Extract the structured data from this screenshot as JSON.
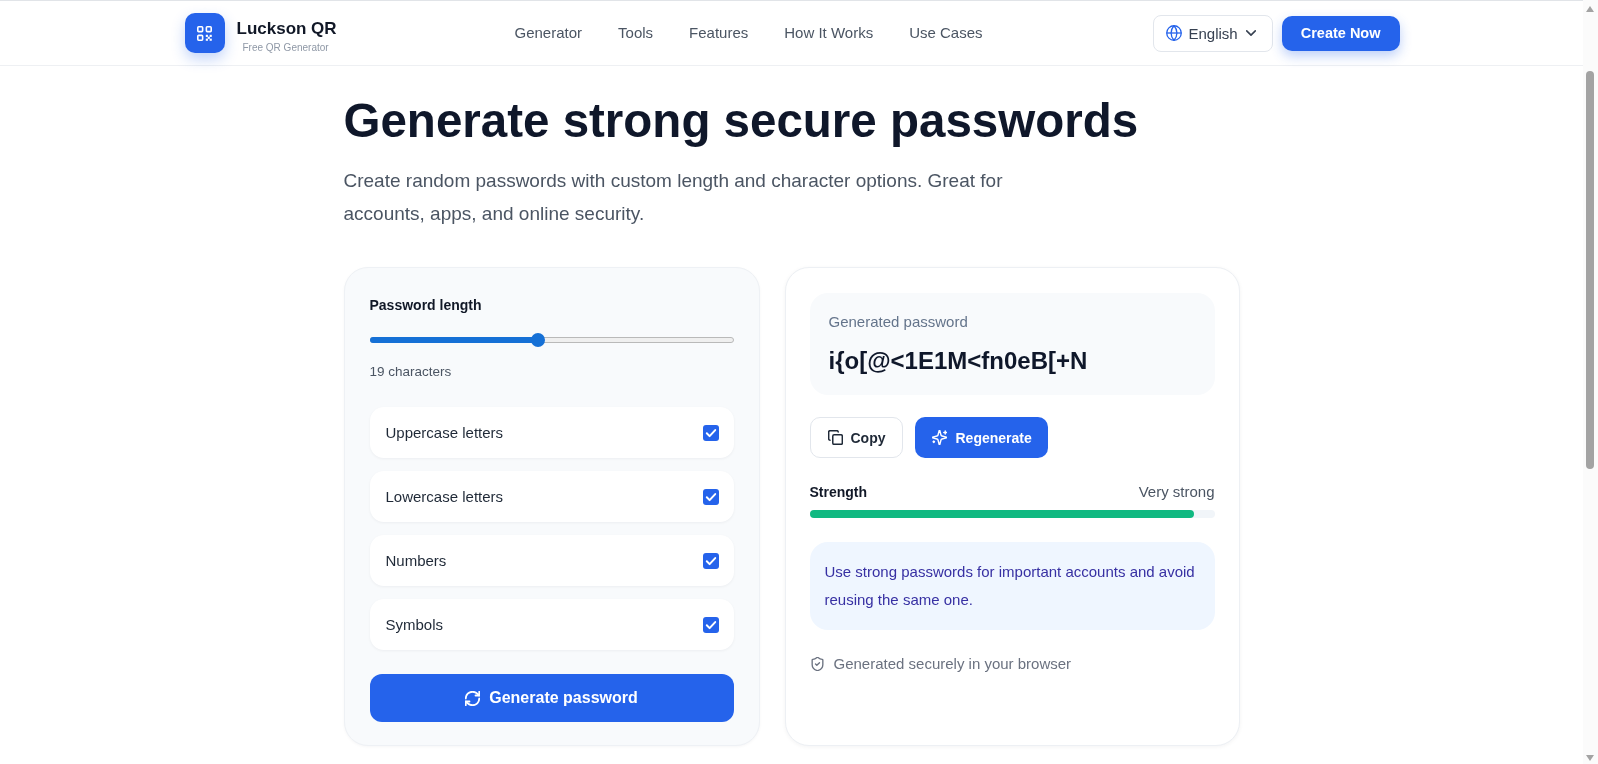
{
  "header": {
    "brand": "Luckson QR",
    "tagline": "Free QR Generator",
    "nav": [
      "Generator",
      "Tools",
      "Features",
      "How It Works",
      "Use Cases"
    ],
    "language": "English",
    "cta": "Create Now"
  },
  "hero": {
    "title": "Generate strong secure passwords",
    "subtitle": "Create random passwords with custom length and character options. Great for accounts, apps, and online security."
  },
  "settings": {
    "length_label": "Password length",
    "length": {
      "level": 0.46
    },
    "length_reading": "19 characters",
    "options": [
      {
        "label": "Uppercase letters",
        "checked": true
      },
      {
        "label": "Lowercase letters",
        "checked": true
      },
      {
        "label": "Numbers",
        "checked": true
      },
      {
        "label": "Symbols",
        "checked": true
      }
    ],
    "generate_button": "Generate password"
  },
  "result": {
    "label": "Generated password",
    "password": "i{o[@<1E1M<fn0eB[+N",
    "actions": [
      {
        "kind": "copy",
        "label": "Copy"
      },
      {
        "kind": "regenerate",
        "label": "Regenerate"
      }
    ],
    "strength": {
      "label": "Strength",
      "reading": "Very strong",
      "level": 0.95
    },
    "tip": "Use strong passwords for important accounts and avoid reusing the same one.",
    "note": "Generated securely in your browser"
  }
}
